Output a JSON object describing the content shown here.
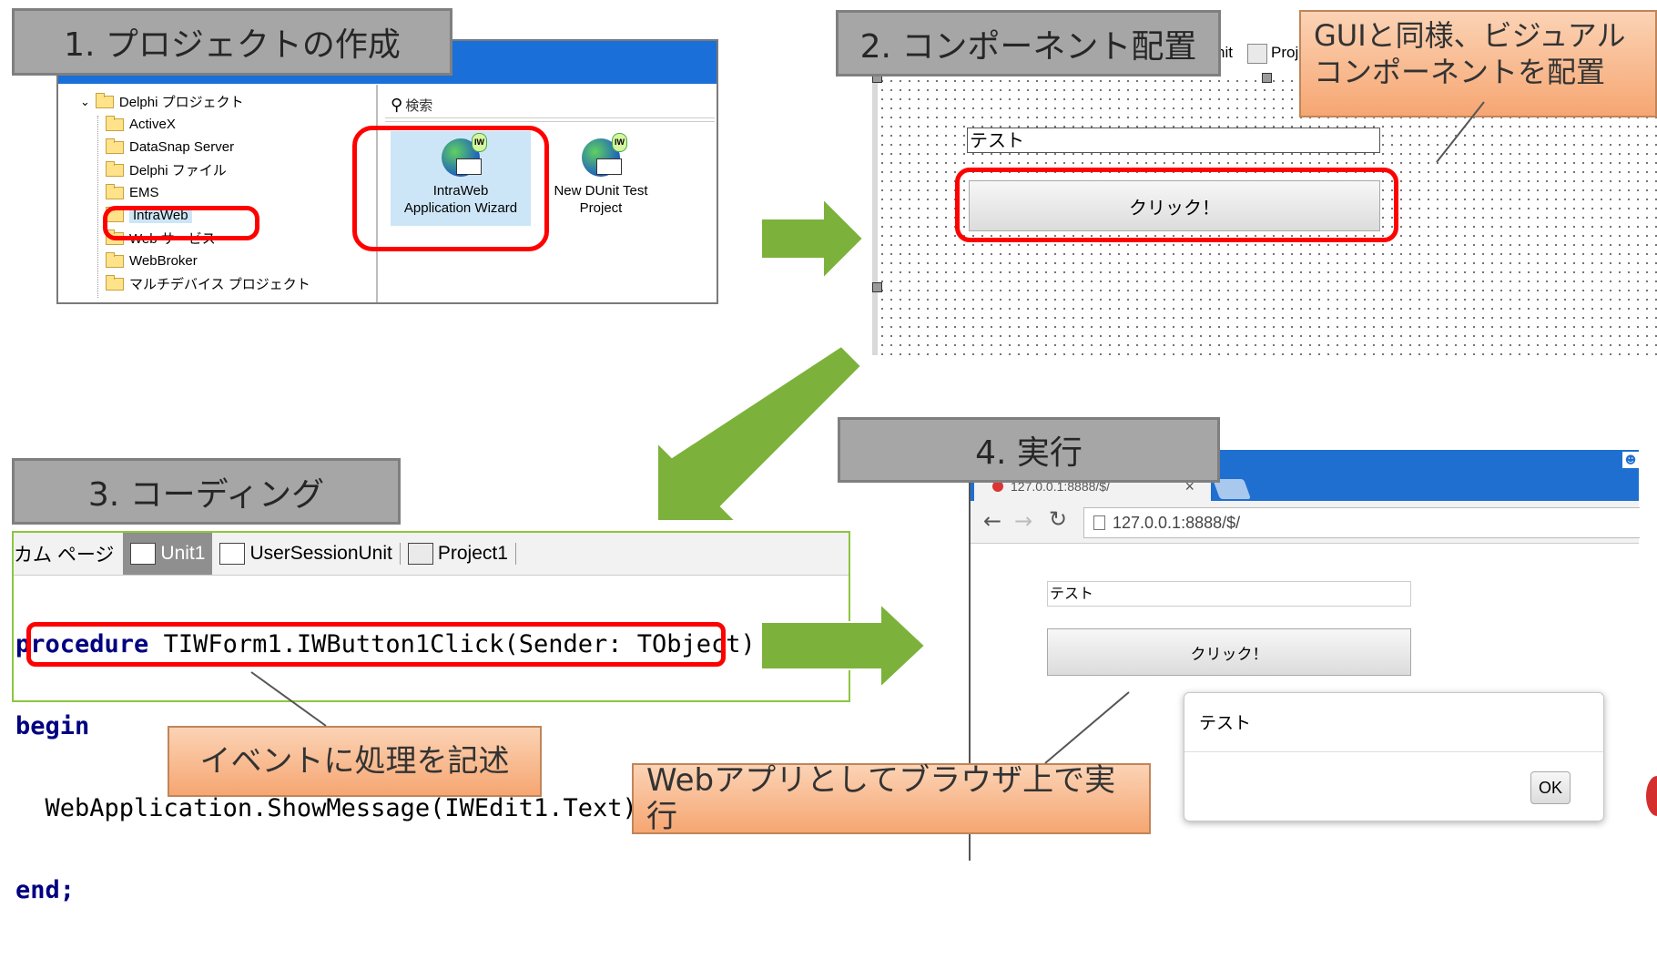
{
  "step1": {
    "label": "1. プロジェクトの作成",
    "search_placeholder": "検索",
    "tree": [
      {
        "label": "Delphi プロジェクト"
      },
      {
        "label": "ActiveX"
      },
      {
        "label": "DataSnap Server"
      },
      {
        "label": "Delphi ファイル"
      },
      {
        "label": "EMS"
      },
      {
        "label": "IntraWeb"
      },
      {
        "label": "Web サービス"
      },
      {
        "label": "WebBroker"
      },
      {
        "label": "マルチデバイス プロジェクト"
      }
    ],
    "items": [
      {
        "line1": "IntraWeb",
        "line2": "Application Wizard",
        "badge": "IW"
      },
      {
        "line1": "New DUnit Test",
        "line2": "Project",
        "badge": "IW"
      }
    ]
  },
  "step2": {
    "label": "2. コンポーネント配置",
    "tab_fragment": "nit",
    "tab_fragment2": "Proj",
    "edit_value": "テスト",
    "button_label": "クリック！",
    "callout_line1": "GUIと同様、ビジュアル",
    "callout_line2": "コンポーネントを配置"
  },
  "step3": {
    "label": "3. コーディング",
    "tabs": [
      {
        "label": "カム ページ"
      },
      {
        "label": "Unit1"
      },
      {
        "label": "UserSessionUnit"
      },
      {
        "label": "Project1"
      }
    ],
    "code": {
      "line1_kw": "procedure",
      "line1_rest": " TIWForm1.IWButton1Click(Sender: TObject);",
      "line2_kw": "begin",
      "line3": "  WebApplication.ShowMessage(IWEdit1.Text);",
      "line4_kw": "end",
      "line4_rest": ";"
    },
    "callout": "イベントに処理を記述"
  },
  "step4": {
    "label": "4. 実行",
    "tab_title": "127.0.0.1:8888/$/",
    "address": "127.0.0.1:8888/$/",
    "edit_value": "テスト",
    "button_label": "クリック！",
    "dialog_message": "テスト",
    "ok_label": "OK",
    "callout": "Webアプリとしてブラウザ上で実行"
  },
  "colors": {
    "arrow_green": "#7cb23b",
    "highlight_red": "#ff0000",
    "label_gray": "#a6a6a6",
    "callout_orange": "#f6a672",
    "titlebar_blue": "#1a6fd8",
    "chrome_blue": "#1f6fd0"
  }
}
